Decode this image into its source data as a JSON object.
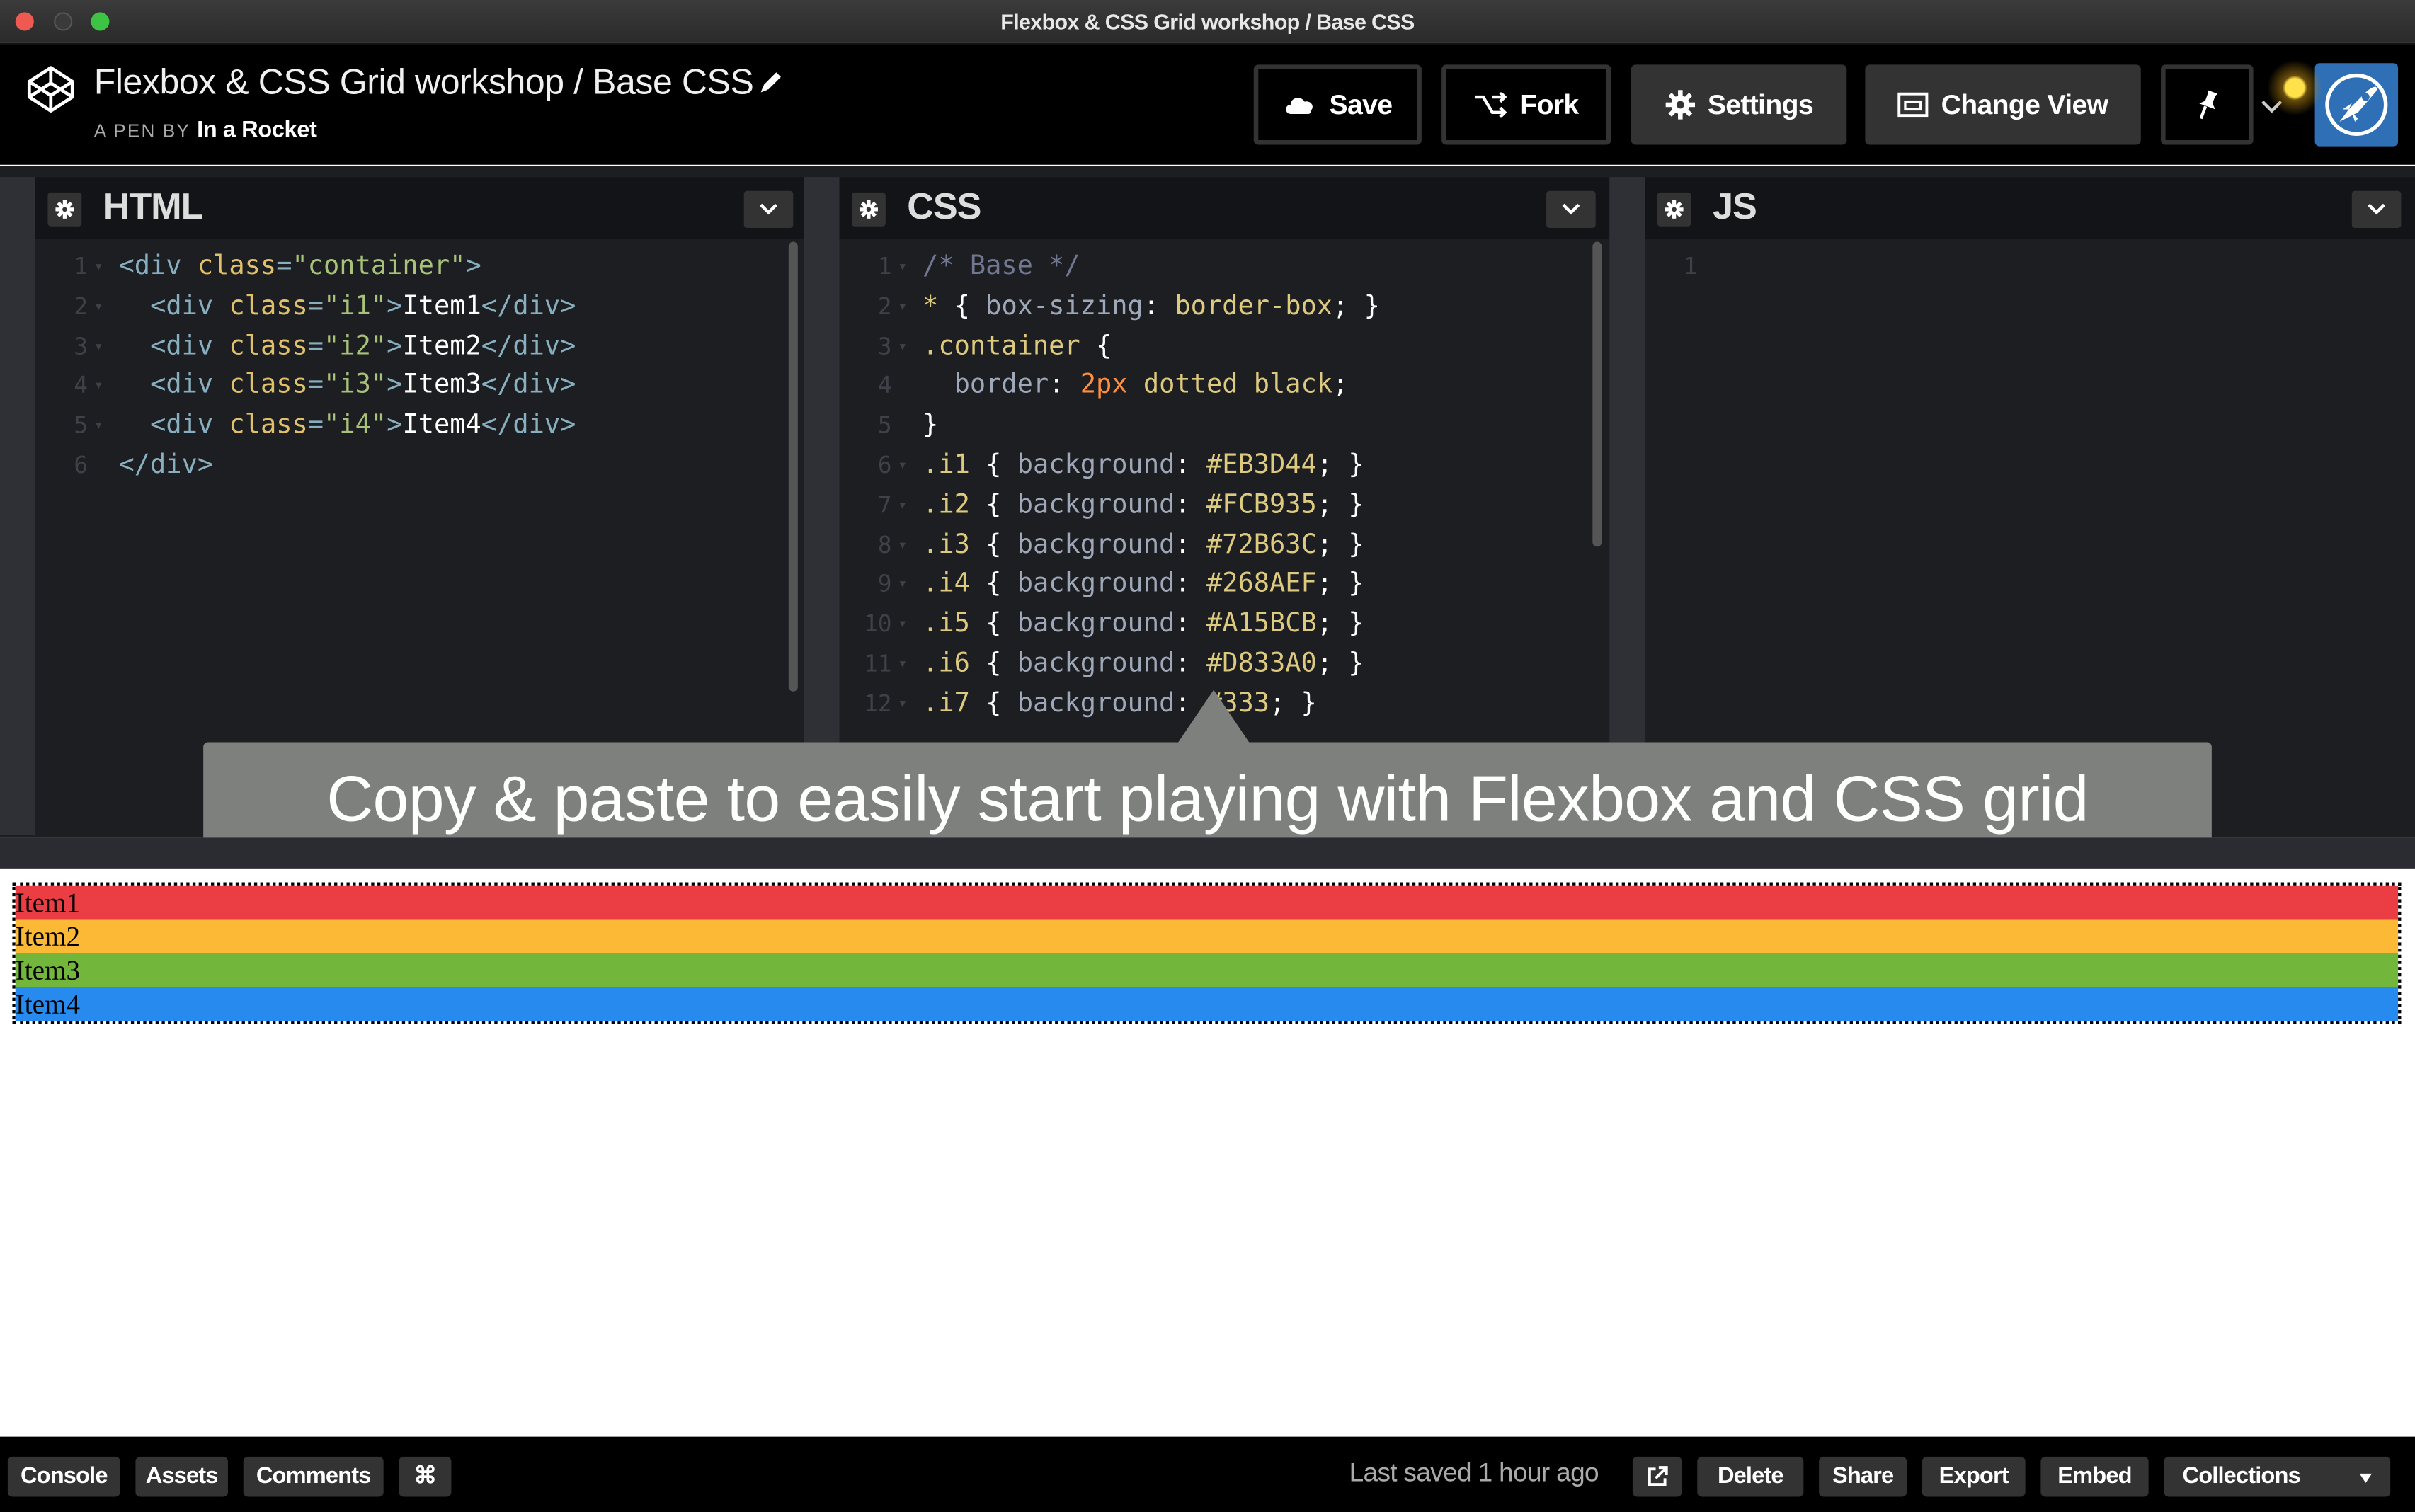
{
  "window": {
    "title": "Flexbox & CSS Grid workshop / Base CSS"
  },
  "header": {
    "pen_title": "Flexbox & CSS Grid workshop / Base CSS",
    "pen_by_label": "A PEN BY",
    "author": "In a Rocket",
    "buttons": {
      "save": "Save",
      "fork": "Fork",
      "settings": "Settings",
      "change_view": "Change View"
    }
  },
  "panels": {
    "html": {
      "title": "HTML",
      "lines": [
        {
          "n": "1",
          "fold": true,
          "tokens": [
            [
              "tag",
              "<div "
            ],
            [
              "attr",
              "class"
            ],
            [
              "tag",
              "="
            ],
            [
              "str",
              "\"container\""
            ],
            [
              "tag",
              ">"
            ]
          ]
        },
        {
          "n": "2",
          "fold": true,
          "tokens": [
            [
              "text",
              "  "
            ],
            [
              "tag",
              "<div "
            ],
            [
              "attr",
              "class"
            ],
            [
              "tag",
              "="
            ],
            [
              "str",
              "\"i1\""
            ],
            [
              "tag",
              ">"
            ],
            [
              "text",
              "Item1"
            ],
            [
              "tag",
              "</div>"
            ]
          ]
        },
        {
          "n": "3",
          "fold": true,
          "tokens": [
            [
              "text",
              "  "
            ],
            [
              "tag",
              "<div "
            ],
            [
              "attr",
              "class"
            ],
            [
              "tag",
              "="
            ],
            [
              "str",
              "\"i2\""
            ],
            [
              "tag",
              ">"
            ],
            [
              "text",
              "Item2"
            ],
            [
              "tag",
              "</div>"
            ]
          ]
        },
        {
          "n": "4",
          "fold": true,
          "tokens": [
            [
              "text",
              "  "
            ],
            [
              "tag",
              "<div "
            ],
            [
              "attr",
              "class"
            ],
            [
              "tag",
              "="
            ],
            [
              "str",
              "\"i3\""
            ],
            [
              "tag",
              ">"
            ],
            [
              "text",
              "Item3"
            ],
            [
              "tag",
              "</div>"
            ]
          ]
        },
        {
          "n": "5",
          "fold": true,
          "tokens": [
            [
              "text",
              "  "
            ],
            [
              "tag",
              "<div "
            ],
            [
              "attr",
              "class"
            ],
            [
              "tag",
              "="
            ],
            [
              "str",
              "\"i4\""
            ],
            [
              "tag",
              ">"
            ],
            [
              "text",
              "Item4"
            ],
            [
              "tag",
              "</div>"
            ]
          ]
        },
        {
          "n": "6",
          "fold": false,
          "tokens": [
            [
              "tag",
              "</div>"
            ]
          ]
        }
      ]
    },
    "css": {
      "title": "CSS",
      "lines": [
        {
          "n": "1",
          "fold": true,
          "tokens": [
            [
              "comment",
              "/* Base */"
            ]
          ]
        },
        {
          "n": "2",
          "fold": true,
          "tokens": [
            [
              "sel",
              "* "
            ],
            [
              "brace",
              "{ "
            ],
            [
              "prop",
              "box-sizing"
            ],
            [
              "brace",
              ": "
            ],
            [
              "val",
              "border-box"
            ],
            [
              "brace",
              "; }"
            ]
          ]
        },
        {
          "n": "3",
          "fold": true,
          "tokens": [
            [
              "sel",
              ".container "
            ],
            [
              "brace",
              "{"
            ]
          ]
        },
        {
          "n": "4",
          "fold": false,
          "tokens": [
            [
              "text",
              "  "
            ],
            [
              "prop",
              "border"
            ],
            [
              "brace",
              ": "
            ],
            [
              "num",
              "2px "
            ],
            [
              "val",
              "dotted black"
            ],
            [
              "brace",
              ";"
            ]
          ]
        },
        {
          "n": "5",
          "fold": false,
          "tokens": [
            [
              "brace",
              "}"
            ]
          ]
        },
        {
          "n": "6",
          "fold": true,
          "tokens": [
            [
              "sel",
              ".i1 "
            ],
            [
              "brace",
              "{ "
            ],
            [
              "prop",
              "background"
            ],
            [
              "brace",
              ": "
            ],
            [
              "val",
              "#EB3D44"
            ],
            [
              "brace",
              "; }"
            ]
          ]
        },
        {
          "n": "7",
          "fold": true,
          "tokens": [
            [
              "sel",
              ".i2 "
            ],
            [
              "brace",
              "{ "
            ],
            [
              "prop",
              "background"
            ],
            [
              "brace",
              ": "
            ],
            [
              "val",
              "#FCB935"
            ],
            [
              "brace",
              "; }"
            ]
          ]
        },
        {
          "n": "8",
          "fold": true,
          "tokens": [
            [
              "sel",
              ".i3 "
            ],
            [
              "brace",
              "{ "
            ],
            [
              "prop",
              "background"
            ],
            [
              "brace",
              ": "
            ],
            [
              "val",
              "#72B63C"
            ],
            [
              "brace",
              "; }"
            ]
          ]
        },
        {
          "n": "9",
          "fold": true,
          "tokens": [
            [
              "sel",
              ".i4 "
            ],
            [
              "brace",
              "{ "
            ],
            [
              "prop",
              "background"
            ],
            [
              "brace",
              ": "
            ],
            [
              "val",
              "#268AEF"
            ],
            [
              "brace",
              "; }"
            ]
          ]
        },
        {
          "n": "10",
          "fold": true,
          "tokens": [
            [
              "sel",
              ".i5 "
            ],
            [
              "brace",
              "{ "
            ],
            [
              "prop",
              "background"
            ],
            [
              "brace",
              ": "
            ],
            [
              "val",
              "#A15BCB"
            ],
            [
              "brace",
              "; }"
            ]
          ]
        },
        {
          "n": "11",
          "fold": true,
          "tokens": [
            [
              "sel",
              ".i6 "
            ],
            [
              "brace",
              "{ "
            ],
            [
              "prop",
              "background"
            ],
            [
              "brace",
              ": "
            ],
            [
              "val",
              "#D833A0"
            ],
            [
              "brace",
              "; }"
            ]
          ]
        },
        {
          "n": "12",
          "fold": true,
          "tokens": [
            [
              "sel",
              ".i7 "
            ],
            [
              "brace",
              "{ "
            ],
            [
              "prop",
              "background"
            ],
            [
              "brace",
              ": "
            ],
            [
              "val",
              "#333"
            ],
            [
              "brace",
              "; }"
            ]
          ]
        }
      ]
    },
    "js": {
      "title": "JS",
      "lines": [
        {
          "n": "1",
          "fold": false,
          "tokens": []
        }
      ]
    }
  },
  "tooltip": {
    "text": "Copy & paste to easily start playing with Flexbox and CSS grid"
  },
  "preview": {
    "items": [
      {
        "label": "Item1",
        "color": "#EB3D44"
      },
      {
        "label": "Item2",
        "color": "#FCB935"
      },
      {
        "label": "Item3",
        "color": "#72B63C"
      },
      {
        "label": "Item4",
        "color": "#268AEF"
      }
    ]
  },
  "footer": {
    "console": "Console",
    "assets": "Assets",
    "comments": "Comments",
    "shortcut_icon": "⌘",
    "last_saved": "Last saved 1 hour ago",
    "delete": "Delete",
    "share": "Share",
    "export": "Export",
    "embed": "Embed",
    "collections": "Collections"
  },
  "colors": {
    "titlebar_close": "#ee5a52",
    "titlebar_zoom": "#3ec445",
    "editor_bg": "#1d1e22",
    "tooltip_bg": "#7d807c",
    "avatar_bg": "#2f6fb5"
  },
  "icons": {
    "logo": "codepen-logo-icon",
    "edit": "pencil-icon",
    "save": "cloud-icon",
    "fork": "fork-icon",
    "settings": "gear-icon",
    "change_view": "layout-icon",
    "pin": "pin-icon",
    "collapse": "chevron-down-icon",
    "external": "external-link-icon",
    "avatar": "rocket-icon"
  }
}
